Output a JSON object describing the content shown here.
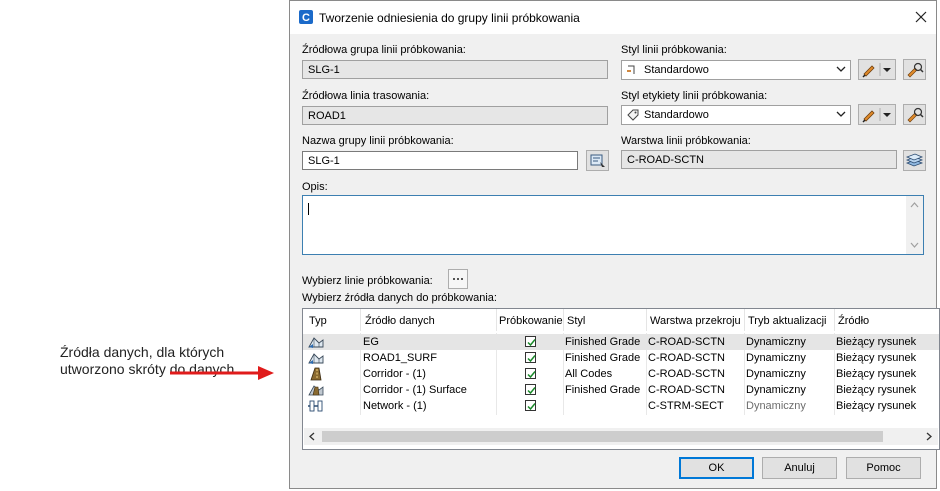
{
  "annotation": {
    "text": "Źródła danych, dla których utworzono skróty do danych"
  },
  "dialog": {
    "title": "Tworzenie odniesienia do grupy linii próbkowania",
    "source_group_label": "Źródłowa grupa linii próbkowania:",
    "source_group_value": "SLG-1",
    "source_alignment_label": "Źródłowa linia trasowania:",
    "source_alignment_value": "ROAD1",
    "group_name_label": "Nazwa grupy linii próbkowania:",
    "group_name_value": "SLG-1",
    "sample_line_style_label": "Styl linii próbkowania:",
    "sample_line_style_value": "Standardowo",
    "sample_label_style_label": "Styl etykiety linii próbkowania:",
    "sample_label_style_value": "Standardowo",
    "layer_label": "Warstwa linii próbkowania:",
    "layer_value": "C-ROAD-SCTN",
    "description_label": "Opis:",
    "description_value": "",
    "select_lines_label": "Wybierz linie próbkowania:",
    "select_sources_label": "Wybierz źródła danych do próbkowania:",
    "ok": "OK",
    "cancel": "Anuluj",
    "help": "Pomoc"
  },
  "table": {
    "headers": [
      "Typ",
      "Źródło danych",
      "Próbkowanie",
      "Styl",
      "Warstwa przekroju",
      "Tryb aktualizacji",
      "Źródło"
    ],
    "rows": [
      {
        "type_icon": "surface-shortcut-icon",
        "source": "EG",
        "sample": true,
        "style": "Finished Grade",
        "layer": "C-ROAD-SCTN",
        "update": "Dynamiczny",
        "origin": "Bieżący rysunek",
        "selected": true
      },
      {
        "type_icon": "surface-shortcut-icon",
        "source": "ROAD1_SURF",
        "sample": true,
        "style": "Finished Grade",
        "layer": "C-ROAD-SCTN",
        "update": "Dynamiczny",
        "origin": "Bieżący rysunek"
      },
      {
        "type_icon": "corridor-icon",
        "source": "Corridor - (1)",
        "sample": true,
        "style": "All Codes",
        "layer": "C-ROAD-SCTN",
        "update": "Dynamiczny",
        "origin": "Bieżący rysunek"
      },
      {
        "type_icon": "corridor-surface-icon",
        "source": "Corridor - (1) Surface",
        "sample": true,
        "style": "Finished Grade",
        "layer": "C-ROAD-SCTN",
        "update": "Dynamiczny",
        "origin": "Bieżący rysunek"
      },
      {
        "type_icon": "pipe-network-icon",
        "source": "Network - (1)",
        "sample": true,
        "style": "",
        "layer": "C-STRM-SECT",
        "update": "Dynamiczny",
        "origin": "Bieżący rysunek",
        "update_dim": true
      }
    ]
  },
  "colors": {
    "accent": "#0078d7",
    "arrow": "#e01b1b",
    "check": "#1a8a2a"
  }
}
